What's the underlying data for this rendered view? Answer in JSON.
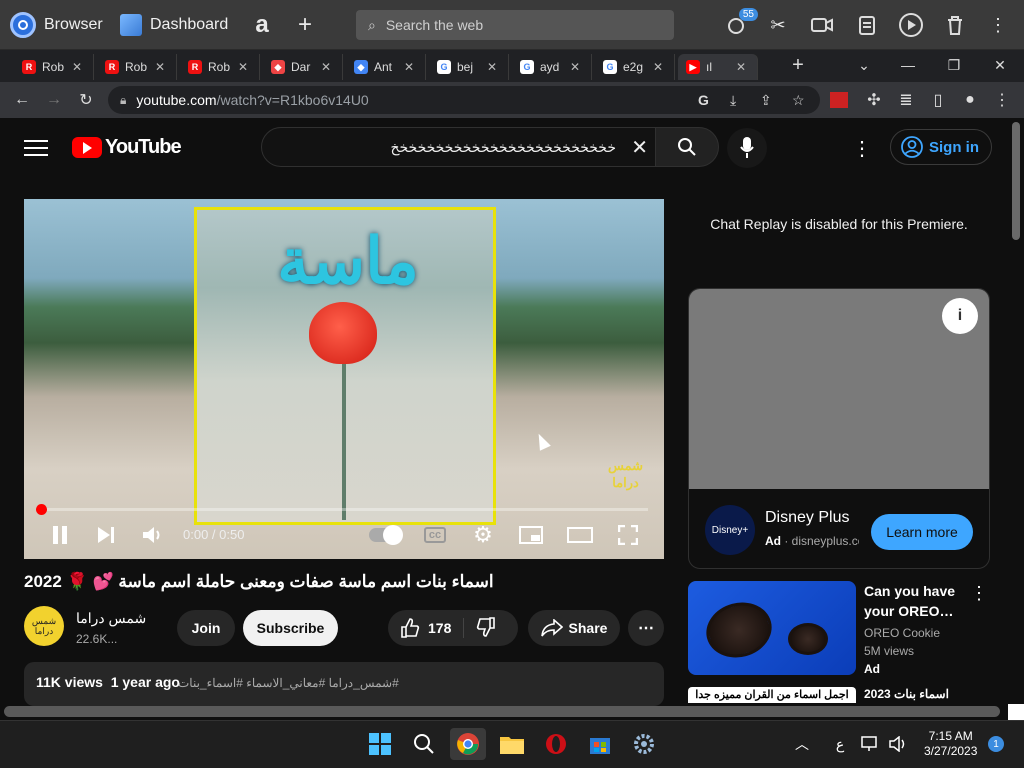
{
  "os_bar": {
    "browser_label": "Browser",
    "dashboard_label": "Dashboard",
    "search_placeholder": "Search the web",
    "notification_count": "55"
  },
  "tabs": [
    {
      "label": "Rob",
      "fav": "R",
      "color": "#e11"
    },
    {
      "label": "Rob",
      "fav": "R",
      "color": "#e11"
    },
    {
      "label": "Rob",
      "fav": "R",
      "color": "#e11"
    },
    {
      "label": "Dar",
      "fav": "◆",
      "color": "#e44"
    },
    {
      "label": "Ant",
      "fav": "◆",
      "color": "#4285f4"
    },
    {
      "label": "bej",
      "fav": "G",
      "color": "#fff"
    },
    {
      "label": "ayd",
      "fav": "G",
      "color": "#fff"
    },
    {
      "label": "e2g",
      "fav": "G",
      "color": "#fff"
    },
    {
      "label": "ıl",
      "fav": "▶",
      "color": "#f00"
    }
  ],
  "address_bar": {
    "domain": "youtube.com",
    "path": "/watch?v=R1kbo6v14U0"
  },
  "youtube": {
    "logo_text": "YouTube",
    "search_value": "خخخخخخخخخخخخخخخخخخخخخخخخخ",
    "sign_in": "Sign in"
  },
  "player": {
    "thumbnail_title": "ماسة",
    "watermark_line1": "شمس",
    "watermark_line2": "دراما",
    "time": "0:00 / 0:50",
    "progress": 0.0
  },
  "video": {
    "title": "اسماء بنات اسم ماسة صفات ومعنى حاملة اسم ماسة 💕 🌹 2022",
    "channel_name": "شمس دراما",
    "channel_subs": "22.6K...",
    "avatar_text": "شمس دراما",
    "join": "Join",
    "subscribe": "Subscribe",
    "likes": "178",
    "share": "Share",
    "views": "11K views",
    "age": "1 year ago",
    "tags": "#شمس_دراما #معاني_الاسماء #اسماء_بنات"
  },
  "sidebar": {
    "chat_disabled": "Chat Replay is disabled for this Premiere.",
    "ad": {
      "title": "Disney Plus",
      "meta_label": "Ad",
      "meta_site": "disneyplus.com",
      "cta": "Learn more",
      "logo": "Disney+"
    },
    "reco1": {
      "title": "Can you have your OREO…",
      "channel": "OREO Cookie",
      "views": "5M views",
      "ad": "Ad"
    },
    "reco2": {
      "thumb_text": "اجمل اسماء من القران مميزه جدا",
      "title": "اسماء بنات 2023"
    }
  },
  "taskbar": {
    "time": "7:15 AM",
    "date": "3/27/2023",
    "lang": "ع",
    "badge": "1"
  }
}
